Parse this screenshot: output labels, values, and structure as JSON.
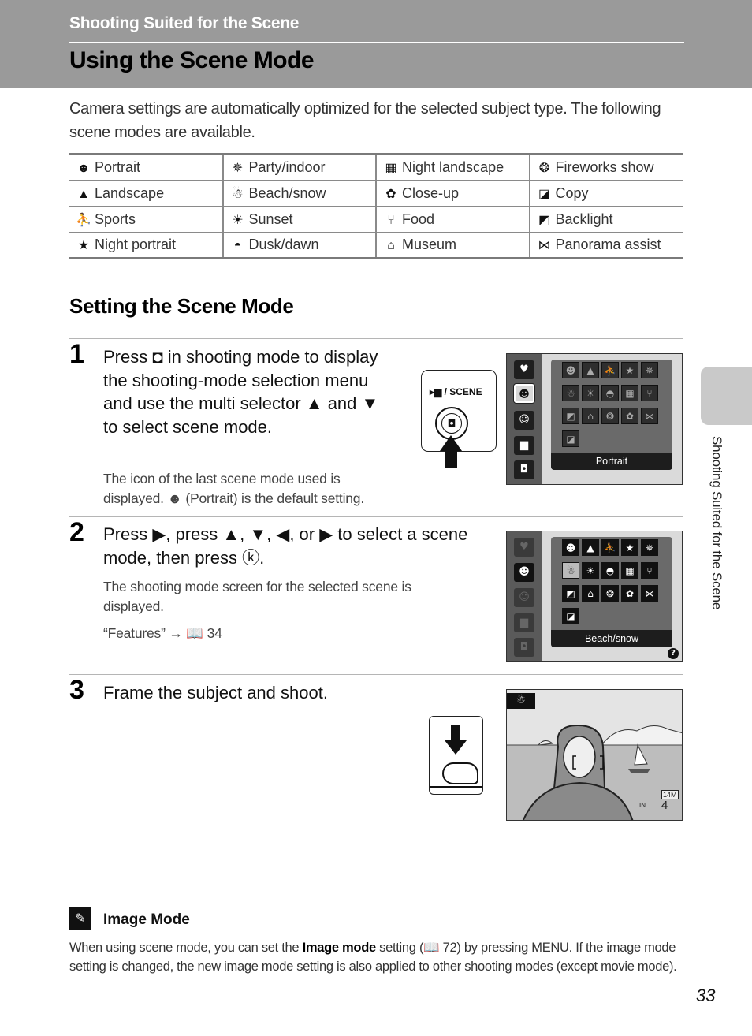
{
  "header": {
    "section": "Shooting Suited for the Scene",
    "title": "Using the Scene Mode"
  },
  "intro": "Camera settings are automatically optimized for the selected subject type. The following scene modes are available.",
  "scene_modes": [
    [
      {
        "icon": "portrait-icon",
        "glyph": "☻",
        "label": "Portrait"
      },
      {
        "icon": "party-indoor-icon",
        "glyph": "✵",
        "label": "Party/indoor"
      },
      {
        "icon": "night-landscape-icon",
        "glyph": "▦",
        "label": "Night landscape"
      },
      {
        "icon": "fireworks-icon",
        "glyph": "❂",
        "label": "Fireworks show"
      }
    ],
    [
      {
        "icon": "landscape-icon",
        "glyph": "▲",
        "label": "Landscape"
      },
      {
        "icon": "beach-snow-icon",
        "glyph": "☃",
        "label": "Beach/snow"
      },
      {
        "icon": "close-up-icon",
        "glyph": "✿",
        "label": "Close-up"
      },
      {
        "icon": "copy-icon",
        "glyph": "◪",
        "label": "Copy"
      }
    ],
    [
      {
        "icon": "sports-icon",
        "glyph": "⛹",
        "label": "Sports"
      },
      {
        "icon": "sunset-icon",
        "glyph": "☀",
        "label": "Sunset"
      },
      {
        "icon": "food-icon",
        "glyph": "⑂",
        "label": "Food"
      },
      {
        "icon": "backlight-icon",
        "glyph": "◩",
        "label": "Backlight"
      }
    ],
    [
      {
        "icon": "night-portrait-icon",
        "glyph": "★",
        "label": "Night portrait"
      },
      {
        "icon": "dusk-dawn-icon",
        "glyph": "◓",
        "label": "Dusk/dawn"
      },
      {
        "icon": "museum-icon",
        "glyph": "⌂",
        "label": "Museum"
      },
      {
        "icon": "panorama-assist-icon",
        "glyph": "⋈",
        "label": "Panorama assist"
      }
    ]
  ],
  "setting": {
    "heading": "Setting the Scene Mode",
    "steps": [
      {
        "number": "1",
        "main": "Press ◘ in shooting mode to display the shooting-mode selection menu and use the multi selector ▲ and ▼ to select scene mode.",
        "sub": "The icon of the last scene mode used is displayed. ☻ (Portrait) is the default setting.",
        "button_label": "▸▆ / SCENE",
        "screen_label": "Portrait"
      },
      {
        "number": "2",
        "main": "Press ▶, press ▲, ▼, ◀, or ▶ to select a scene mode, then press ⓚ.",
        "sub": "The shooting mode screen for the selected scene is displayed.",
        "ref": "“Features” → 📖 34",
        "screen_label": "Beach/snow",
        "help_glyph": "?"
      },
      {
        "number": "3",
        "main": "Frame the subject and shoot.",
        "viewfinder": {
          "mode_glyph": "☃",
          "image_size": "14M",
          "memory": "IN",
          "shots_remaining": "4"
        }
      }
    ]
  },
  "note": {
    "icon_glyph": "✎",
    "title": "Image Mode",
    "body_before": "When using scene mode, you can set the ",
    "body_bold": "Image mode",
    "body_after": " setting (📖 72) by pressing MENU. If the image mode setting is changed, the new image mode setting is also applied to other shooting modes (except movie mode)."
  },
  "side_tab_text": "Shooting Suited for the Scene",
  "page_number": "33"
}
